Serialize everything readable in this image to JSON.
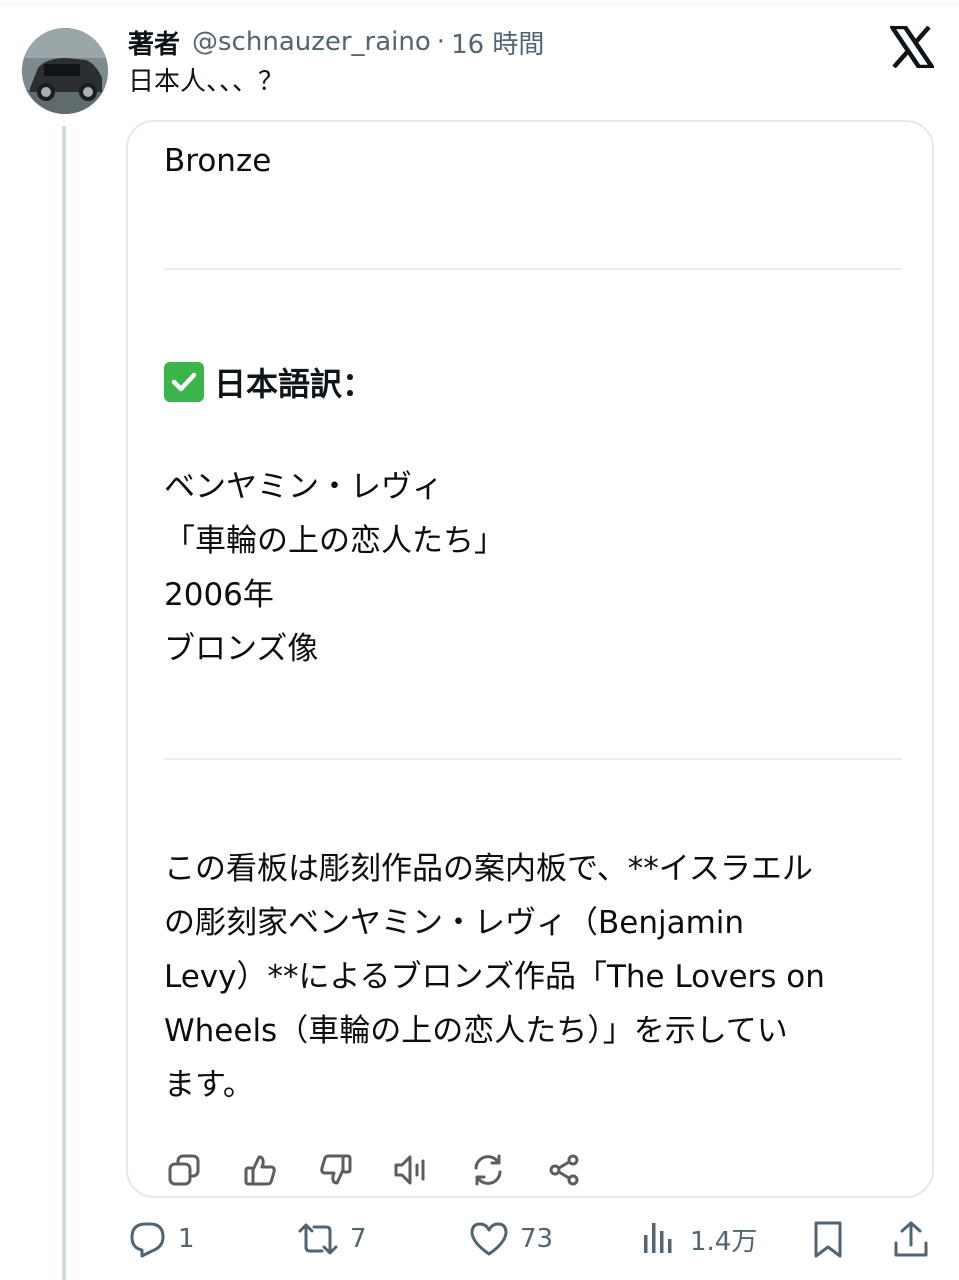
{
  "post": {
    "display_name": "著者",
    "handle": "@schnauzer_raino",
    "separator": "·",
    "time": "16 時間",
    "text": "日本人、、、？"
  },
  "card": {
    "line_bronze": "Bronze",
    "heading": "日本語訳：",
    "translation": [
      "ベンヤミン・レヴィ",
      "「車輪の上の恋人たち」",
      "2006年",
      "ブロンズ像"
    ],
    "paragraph": [
      "この看板は彫刻作品の案内板で、**イスラエル",
      "の彫刻家ベンヤミン・レヴィ（Benjamin",
      "Levy）**によるブロンズ作品「The Lovers on",
      "Wheels（車輪の上の恋人たち）」を示してい",
      "ます。"
    ],
    "actions": [
      "copy-icon",
      "thumbs-up-icon",
      "thumbs-down-icon",
      "speaker-icon",
      "regenerate-icon",
      "share-icon"
    ]
  },
  "footer": {
    "replies": "1",
    "reposts": "7",
    "likes": "73",
    "views": "1.4万"
  },
  "colors": {
    "thread_line": "#cfd9de",
    "secondary_text": "#536471",
    "check_green": "#3bb54a"
  }
}
